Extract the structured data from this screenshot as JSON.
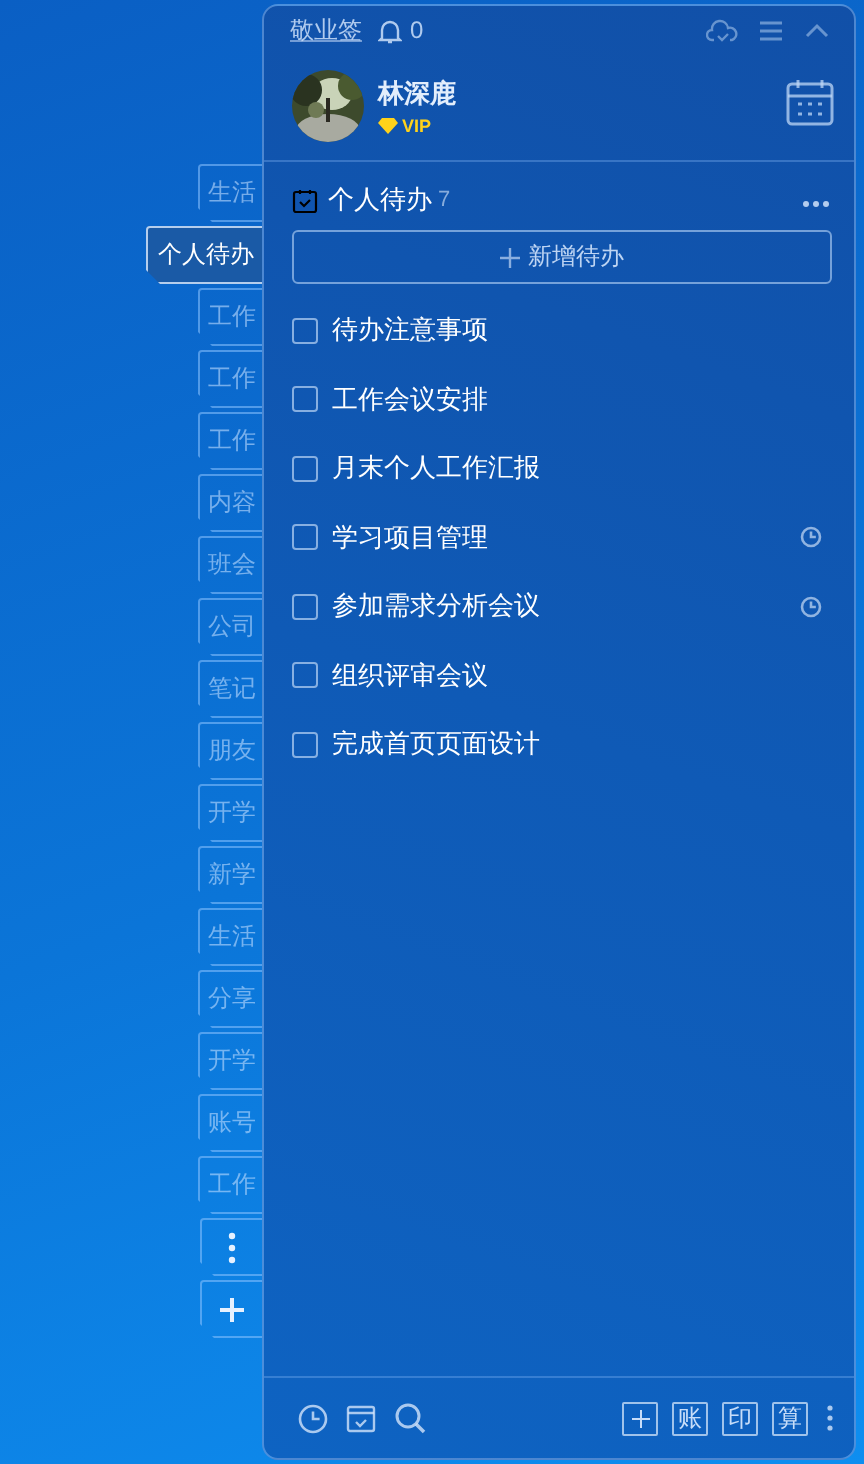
{
  "side_tabs": [
    {
      "label": "生活",
      "selected": false
    },
    {
      "label": "个人待办",
      "selected": true
    },
    {
      "label": "工作",
      "selected": false
    },
    {
      "label": "工作",
      "selected": false
    },
    {
      "label": "工作",
      "selected": false
    },
    {
      "label": "内容",
      "selected": false
    },
    {
      "label": "班会",
      "selected": false
    },
    {
      "label": "公司",
      "selected": false
    },
    {
      "label": "笔记",
      "selected": false
    },
    {
      "label": "朋友",
      "selected": false
    },
    {
      "label": "开学",
      "selected": false
    },
    {
      "label": "新学",
      "selected": false
    },
    {
      "label": "生活",
      "selected": false
    },
    {
      "label": "分享",
      "selected": false
    },
    {
      "label": "开学",
      "selected": false
    },
    {
      "label": "账号",
      "selected": false
    },
    {
      "label": "工作",
      "selected": false
    }
  ],
  "top_bar": {
    "brand": "敬业签",
    "notification_count": "0"
  },
  "profile": {
    "name": "林深鹿",
    "badge": "VIP"
  },
  "todo_list": {
    "title": "个人待办",
    "count": "7",
    "add_label": "新增待办",
    "items": [
      {
        "text": "待办注意事项",
        "checked": false,
        "reminder": false
      },
      {
        "text": "工作会议安排",
        "checked": false,
        "reminder": false
      },
      {
        "text": "月末个人工作汇报",
        "checked": false,
        "reminder": false
      },
      {
        "text": "学习项目管理",
        "checked": false,
        "reminder": true
      },
      {
        "text": "参加需求分析会议",
        "checked": false,
        "reminder": true
      },
      {
        "text": "组织评审会议",
        "checked": false,
        "reminder": false
      },
      {
        "text": "完成首页页面设计",
        "checked": false,
        "reminder": false
      }
    ]
  },
  "footer": {
    "tools": [
      "账",
      "印",
      "算"
    ]
  }
}
